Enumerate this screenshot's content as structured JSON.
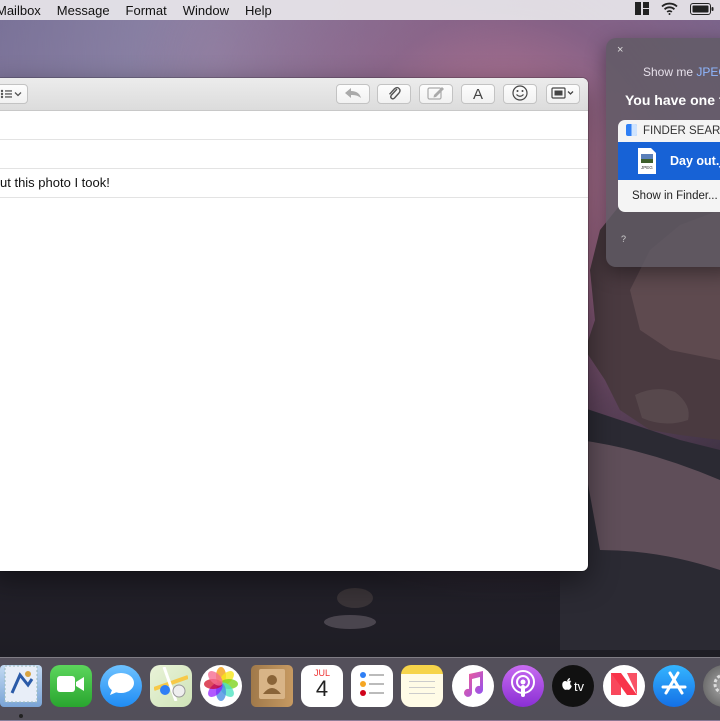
{
  "menubar": {
    "items": [
      "Mailbox",
      "Message",
      "Format",
      "Window",
      "Help"
    ]
  },
  "mail": {
    "subject_fragment": "ut this photo I took!",
    "toolbar": {
      "font_label": "A"
    }
  },
  "siri": {
    "close_glyph": "×",
    "query_prefix": "Show me ",
    "query_highlight": "JPEG",
    "answer": "You have one fi",
    "card": {
      "header": "FINDER SEARC",
      "file_name": "Day out.j",
      "file_type": "JPEG",
      "show_in_finder": "Show in Finder..."
    },
    "help_glyph": "?"
  },
  "dock": {
    "calendar_month": "JUL",
    "calendar_day": "4",
    "tv_label": "tv"
  }
}
